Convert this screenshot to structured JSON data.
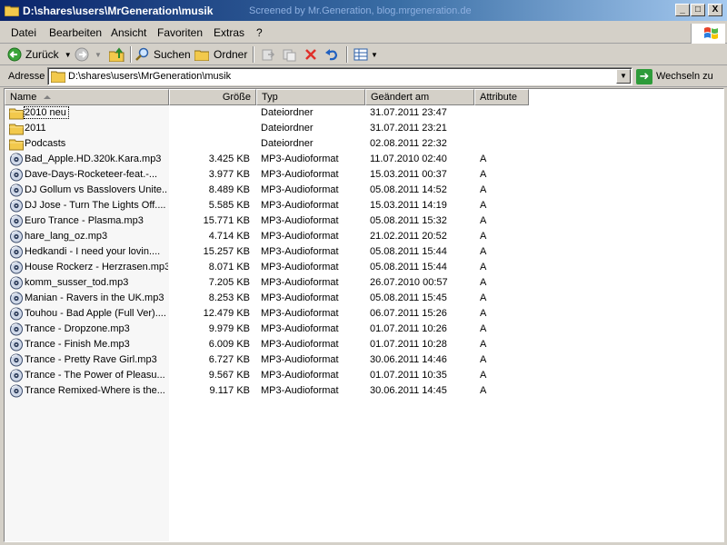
{
  "window": {
    "title": "D:\\shares\\users\\MrGeneration\\musik",
    "watermark": "Screened by Mr.Generation, blog.mrgeneration.de",
    "controls": {
      "minimize": "_",
      "maximize": "□",
      "close": "X"
    }
  },
  "menu": [
    "Datei",
    "Bearbeiten",
    "Ansicht",
    "Favoriten",
    "Extras",
    "?"
  ],
  "toolbar": {
    "back_label": "Zurück",
    "search_label": "Suchen",
    "folders_label": "Ordner"
  },
  "address": {
    "label": "Adresse",
    "value": "D:\\shares\\users\\MrGeneration\\musik",
    "go_label": "Wechseln zu"
  },
  "columns": [
    "Name",
    "Größe",
    "Typ",
    "Geändert am",
    "Attribute"
  ],
  "files": [
    {
      "icon": "folder-icon",
      "name": "2010 neu",
      "size": "",
      "type": "Dateiordner",
      "date": "31.07.2011 23:47",
      "attr": ""
    },
    {
      "icon": "folder-icon",
      "name": "2011",
      "size": "",
      "type": "Dateiordner",
      "date": "31.07.2011 23:21",
      "attr": ""
    },
    {
      "icon": "folder-icon",
      "name": "Podcasts",
      "size": "",
      "type": "Dateiordner",
      "date": "02.08.2011 22:32",
      "attr": ""
    },
    {
      "icon": "mp3-icon",
      "name": "Bad_Apple.HD.320k.Kara.mp3",
      "size": "3.425 KB",
      "type": "MP3-Audioformat",
      "date": "11.07.2010 02:40",
      "attr": "A"
    },
    {
      "icon": "mp3-icon",
      "name": "Dave-Days-Rocketeer-feat.-...",
      "size": "3.977 KB",
      "type": "MP3-Audioformat",
      "date": "15.03.2011 00:37",
      "attr": "A"
    },
    {
      "icon": "mp3-icon",
      "name": "DJ Gollum vs Basslovers Unite...",
      "size": "8.489 KB",
      "type": "MP3-Audioformat",
      "date": "05.08.2011 14:52",
      "attr": "A"
    },
    {
      "icon": "mp3-icon",
      "name": "DJ Jose - Turn The Lights Off....",
      "size": "5.585 KB",
      "type": "MP3-Audioformat",
      "date": "15.03.2011 14:19",
      "attr": "A"
    },
    {
      "icon": "mp3-icon",
      "name": "Euro Trance - Plasma.mp3",
      "size": "15.771 KB",
      "type": "MP3-Audioformat",
      "date": "05.08.2011 15:32",
      "attr": "A"
    },
    {
      "icon": "mp3-icon",
      "name": "hare_lang_oz.mp3",
      "size": "4.714 KB",
      "type": "MP3-Audioformat",
      "date": "21.02.2011 20:52",
      "attr": "A"
    },
    {
      "icon": "mp3-icon",
      "name": "Hedkandi - I need your lovin....",
      "size": "15.257 KB",
      "type": "MP3-Audioformat",
      "date": "05.08.2011 15:44",
      "attr": "A"
    },
    {
      "icon": "mp3-icon",
      "name": "House Rockerz - Herzrasen.mp3",
      "size": "8.071 KB",
      "type": "MP3-Audioformat",
      "date": "05.08.2011 15:44",
      "attr": "A"
    },
    {
      "icon": "mp3-icon",
      "name": "komm_susser_tod.mp3",
      "size": "7.205 KB",
      "type": "MP3-Audioformat",
      "date": "26.07.2010 00:57",
      "attr": "A"
    },
    {
      "icon": "mp3-icon",
      "name": "Manian - Ravers in the UK.mp3",
      "size": "8.253 KB",
      "type": "MP3-Audioformat",
      "date": "05.08.2011 15:45",
      "attr": "A"
    },
    {
      "icon": "mp3-icon",
      "name": "Touhou - Bad Apple (Full Ver)....",
      "size": "12.479 KB",
      "type": "MP3-Audioformat",
      "date": "06.07.2011 15:26",
      "attr": "A"
    },
    {
      "icon": "mp3-icon",
      "name": "Trance - Dropzone.mp3",
      "size": "9.979 KB",
      "type": "MP3-Audioformat",
      "date": "01.07.2011 10:26",
      "attr": "A"
    },
    {
      "icon": "mp3-icon",
      "name": "Trance - Finish Me.mp3",
      "size": "6.009 KB",
      "type": "MP3-Audioformat",
      "date": "01.07.2011 10:28",
      "attr": "A"
    },
    {
      "icon": "mp3-icon",
      "name": "Trance - Pretty Rave Girl.mp3",
      "size": "6.727 KB",
      "type": "MP3-Audioformat",
      "date": "30.06.2011 14:46",
      "attr": "A"
    },
    {
      "icon": "mp3-icon",
      "name": "Trance - The Power of Pleasu...",
      "size": "9.567 KB",
      "type": "MP3-Audioformat",
      "date": "01.07.2011 10:35",
      "attr": "A"
    },
    {
      "icon": "mp3-icon",
      "name": "Trance Remixed-Where is the...",
      "size": "9.117 KB",
      "type": "MP3-Audioformat",
      "date": "30.06.2011 14:45",
      "attr": "A"
    }
  ],
  "colors": {
    "titlebar_start": "#0a246a",
    "titlebar_end": "#a6caf0",
    "chrome": "#d4d0c8",
    "folder": "#f2c94c"
  }
}
